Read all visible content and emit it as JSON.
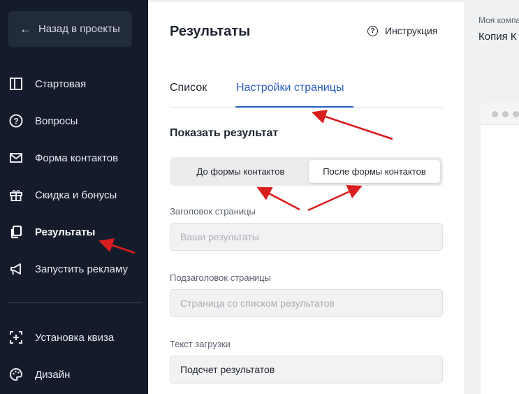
{
  "sidebar": {
    "back_label": "Назад в проекты",
    "items": [
      {
        "label": "Стартовая",
        "icon": "layout-icon"
      },
      {
        "label": "Вопросы",
        "icon": "question-circle-icon"
      },
      {
        "label": "Форма контактов",
        "icon": "envelope-icon"
      },
      {
        "label": "Скидка и бонусы",
        "icon": "gift-icon"
      },
      {
        "label": "Результаты",
        "icon": "copy-pages-icon",
        "active": true
      },
      {
        "label": "Запустить рекламу",
        "icon": "megaphone-icon"
      }
    ],
    "bottom_items": [
      {
        "label": "Установка квиза",
        "icon": "embed-icon"
      },
      {
        "label": "Дизайн",
        "icon": "palette-icon"
      }
    ]
  },
  "main": {
    "title": "Результаты",
    "instruction_label": "Инструкция",
    "tabs": [
      {
        "label": "Список",
        "active": false
      },
      {
        "label": "Настройки страницы",
        "active": true
      }
    ],
    "section_title": "Показать результат",
    "segmented": {
      "options": [
        "До формы контактов",
        "После формы контактов"
      ],
      "selected": "После формы контактов"
    },
    "fields": {
      "page_title_label": "Заголовок страницы",
      "page_title_placeholder": "Ваши результаты",
      "page_subtitle_label": "Подзаголовок страницы",
      "page_subtitle_placeholder": "Страница со списком результатов",
      "loading_text_label": "Текст загрузки",
      "loading_text_value": "Подсчет результатов"
    }
  },
  "preview": {
    "company": "Моя компания",
    "copy_title": "Копия К"
  },
  "colors": {
    "sidebar_bg": "#141c2b",
    "accent": "#2a5fbf",
    "annotation_arrow": "#d81e1e"
  }
}
